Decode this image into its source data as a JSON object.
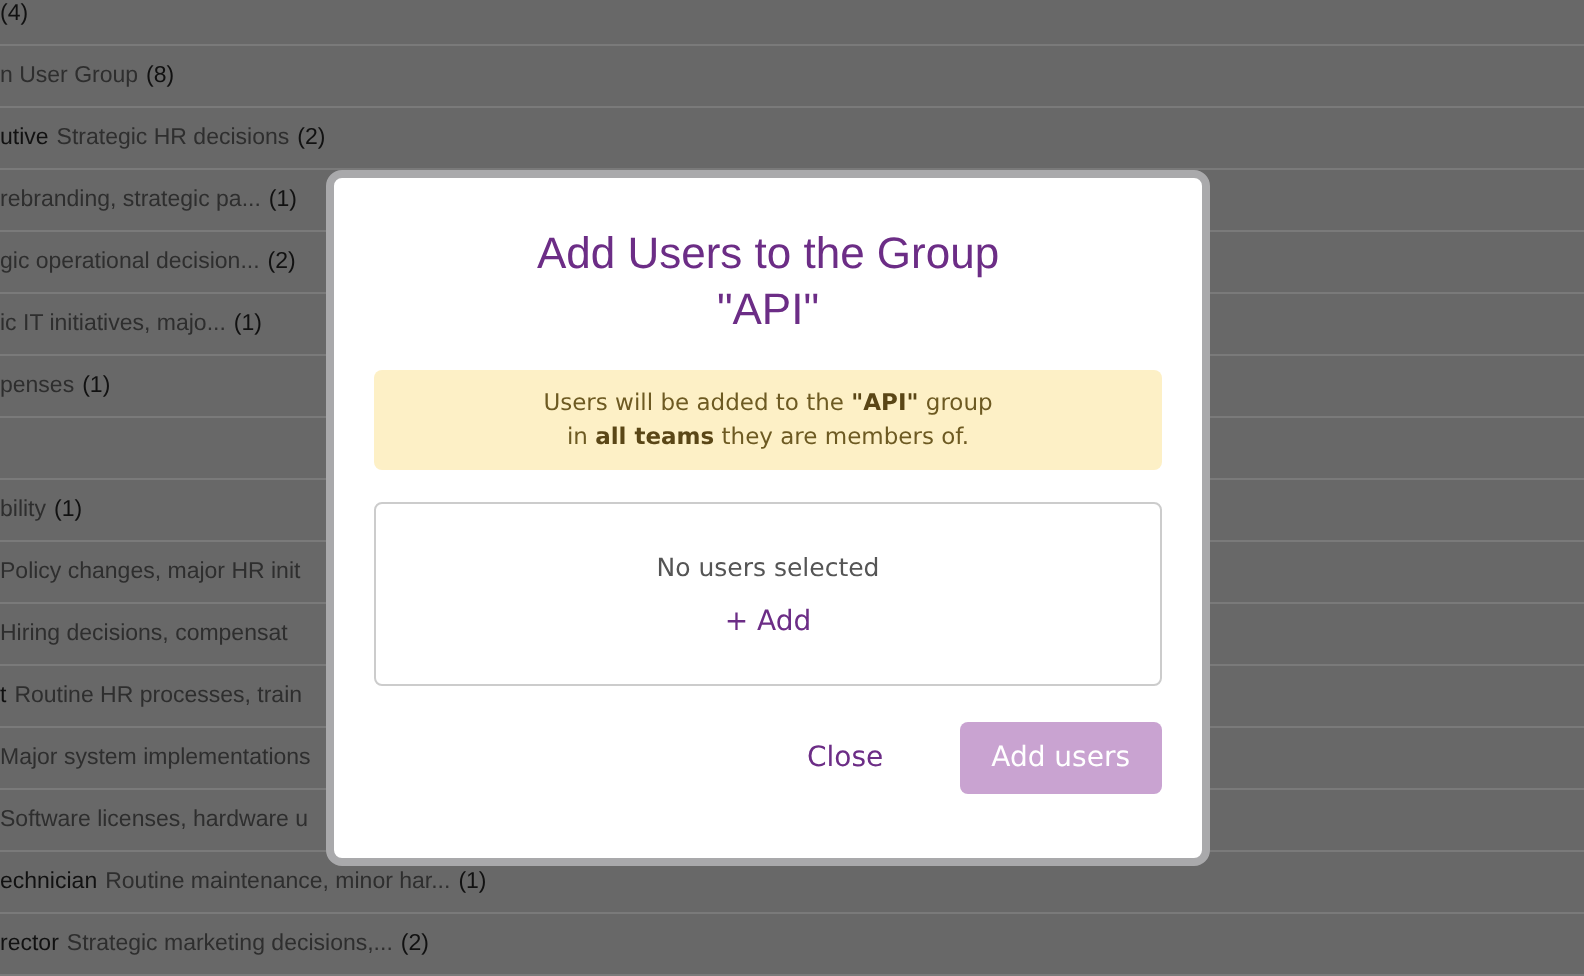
{
  "background_list": [
    {
      "count": "(4)"
    },
    {
      "description": "n User Group",
      "count": "(8)"
    },
    {
      "name": "utive",
      "description": "Strategic HR decisions",
      "count": "(2)"
    },
    {
      "description": "rebranding, strategic pa...",
      "count": "(1)"
    },
    {
      "description": "gic operational decision...",
      "count": "(2)"
    },
    {
      "description": "ic IT initiatives, majo...",
      "count": "(1)"
    },
    {
      "description": "penses",
      "count": "(1)"
    },
    {
      "gap_before": true,
      "description": "bility",
      "count": "(1)"
    },
    {
      "description": "Policy changes, major HR init"
    },
    {
      "description": "Hiring decisions, compensat"
    },
    {
      "name": "t",
      "description": "Routine HR processes, train"
    },
    {
      "description": "Major system implementations"
    },
    {
      "description": "Software licenses, hardware u"
    },
    {
      "name": "echnician",
      "description": "Routine maintenance, minor har...",
      "count": "(1)"
    },
    {
      "name": "rector",
      "description": "Strategic marketing decisions,...",
      "count": "(2)"
    }
  ],
  "dialog": {
    "title_line1": "Add Users to the Group",
    "title_line2": "\"API\"",
    "notice": "Users will be added to the **\"API\"** group\nin **all teams** they are members of.",
    "empty_text": "No users selected",
    "add_link": "+ Add",
    "buttons": [
      {
        "label": "Close",
        "kind": "link",
        "disabled": false
      },
      {
        "label": "Add users",
        "kind": "primary",
        "disabled": true
      }
    ]
  }
}
